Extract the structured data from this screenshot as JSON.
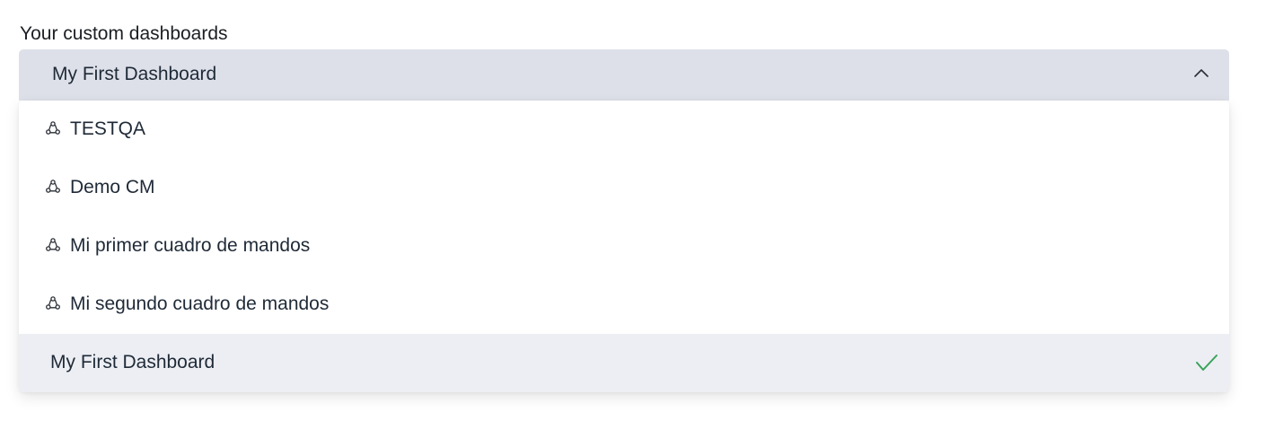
{
  "field": {
    "label": "Your custom dashboards",
    "selected_value": "My First Dashboard",
    "chevron_icon": "chevron-up-icon"
  },
  "menu": {
    "items": [
      {
        "label": "TESTQA",
        "icon": "shared-icon",
        "selected": false
      },
      {
        "label": "Demo CM",
        "icon": "shared-icon",
        "selected": false
      },
      {
        "label": "Mi primer cuadro de mandos",
        "icon": "shared-icon",
        "selected": false
      },
      {
        "label": "Mi segundo cuadro de mandos",
        "icon": "shared-icon",
        "selected": false
      },
      {
        "label": "My First Dashboard",
        "icon": "",
        "selected": true
      }
    ],
    "check_icon": "checkmark-icon",
    "check_color": "#3aa35a"
  }
}
